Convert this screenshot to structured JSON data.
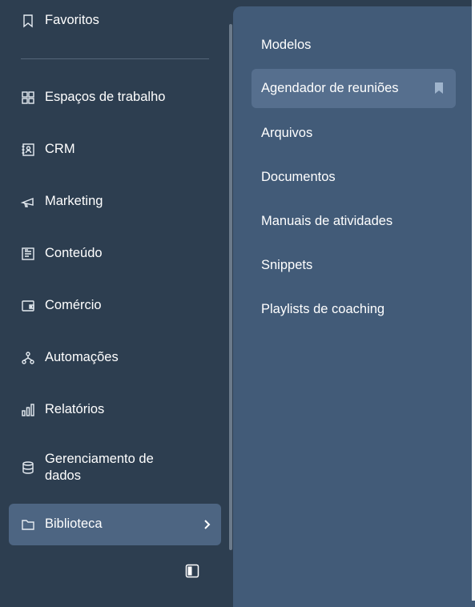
{
  "sidebar": {
    "favorites": "Favoritos",
    "items": [
      {
        "label": "Espaços de trabalho",
        "icon": "grid-icon"
      },
      {
        "label": "CRM",
        "icon": "contact-card-icon"
      },
      {
        "label": "Marketing",
        "icon": "megaphone-icon"
      },
      {
        "label": "Conteúdo",
        "icon": "content-icon"
      },
      {
        "label": "Comércio",
        "icon": "wallet-icon"
      },
      {
        "label": "Automações",
        "icon": "workflow-icon"
      },
      {
        "label": "Relatórios",
        "icon": "bar-chart-icon"
      },
      {
        "label": "Gerenciamento de dados",
        "icon": "database-icon"
      }
    ],
    "active": {
      "label": "Biblioteca",
      "icon": "folder-icon"
    }
  },
  "flyout": {
    "items": [
      "Modelos",
      "Agendador de reuniões",
      "Arquivos",
      "Documentos",
      "Manuais de atividades",
      "Snippets",
      "Playlists de coaching"
    ],
    "highlighted_index": 1
  },
  "colors": {
    "sidebar_bg": "#2d3e50",
    "flyout_bg": "#425b78",
    "active_bg": "#4d6582",
    "highlight_bg": "#566f8e"
  }
}
